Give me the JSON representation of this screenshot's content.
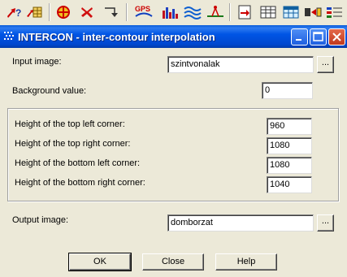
{
  "toolbar": {
    "icons": [
      "help-cursor-icon",
      "layer-grid-icon",
      "target-icon",
      "red-x-icon",
      "route-arrow-icon",
      "gps-icon",
      "histogram-icon",
      "waves-icon",
      "profile-icon",
      "export-icon",
      "table-icon",
      "attribute-table-icon",
      "convert-icon",
      "legend-icon"
    ],
    "gps_label": "GPS"
  },
  "window": {
    "title": "INTERCON - inter-contour interpolation",
    "titlebar_color": "#0055e5"
  },
  "form": {
    "input_image_label": "Input image:",
    "input_image_value": "szintvonalak",
    "background_label": "Background value:",
    "background_value": "0",
    "top_left_label": "Height of the top left corner:",
    "top_left_value": "960",
    "top_right_label": "Height of the top right corner:",
    "top_right_value": "1080",
    "bottom_left_label": "Height of the bottom left corner:",
    "bottom_left_value": "1080",
    "bottom_right_label": "Height of the bottom right corner:",
    "bottom_right_value": "1040",
    "output_image_label": "Output image:",
    "output_image_value": "domborzat",
    "browse_label": "..."
  },
  "buttons": {
    "ok": "OK",
    "close": "Close",
    "help": "Help"
  }
}
